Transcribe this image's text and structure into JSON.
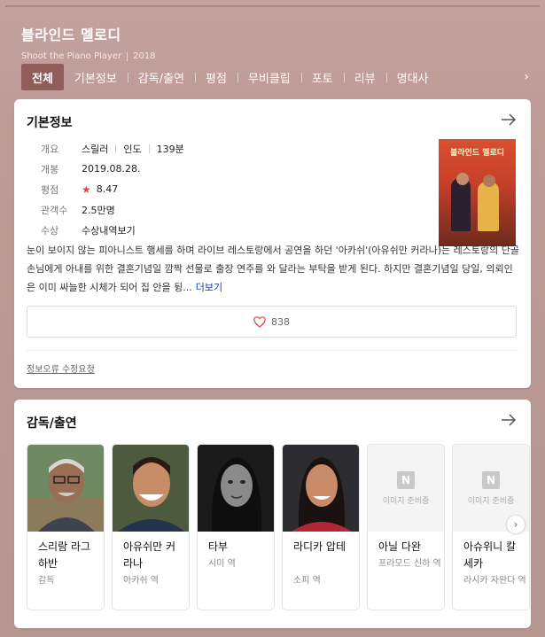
{
  "header": {
    "title": "블라인드 멜로디",
    "subtitle_en": "Shoot the Piano Player",
    "year": "2018"
  },
  "tabs": [
    {
      "label": "전체",
      "active": true
    },
    {
      "label": "기본정보"
    },
    {
      "label": "감독/출연"
    },
    {
      "label": "평점"
    },
    {
      "label": "무비클립"
    },
    {
      "label": "포토"
    },
    {
      "label": "리뷰"
    },
    {
      "label": "명대사"
    }
  ],
  "basic": {
    "title": "기본정보",
    "genre_label": "개요",
    "genre": "스릴러",
    "country": "인도",
    "runtime": "139분",
    "release_label": "개봉",
    "release": "2019.08.28.",
    "rating_label": "평점",
    "rating": "8.47",
    "audience_label": "관객수",
    "audience": "2.5만명",
    "award_label": "수상",
    "award_link": "수상내역보기",
    "poster_title": "블라인드 멜로디",
    "synopsis": "눈이 보이지 않는 피아니스트 행세를 하며 라이브 레스토랑에서 공연을 하던 '아카쉬'(아유쉬만 커라나)는 레스토랑의 단골 손님에게 아내를 위한 결혼기념일 깜짝 선물로 출장 연주를 와 달라는 부탁을 받게 된다. 하지만 결혼기념일 당일, 의뢰인은 이미 싸늘한 시체가 되어 집 안을 뒹...",
    "more": "더보기",
    "likes": "838",
    "report": "정보오류 수정요청"
  },
  "cast": {
    "title": "감독/출연",
    "no_image_text": "이미지 준비중",
    "people": [
      {
        "name": "스리람 라그하반",
        "role": "감독"
      },
      {
        "name": "아유쉬만 커라나",
        "role": "아카쉬 역"
      },
      {
        "name": "타부",
        "role": "시미 역"
      },
      {
        "name": "라디카 압테",
        "role": "소피 역"
      },
      {
        "name": "아닐 다완",
        "role": "프라모드 신하 역"
      },
      {
        "name": "아슈위니 칼세카",
        "role": "라시카 자완다 역"
      }
    ]
  },
  "colors": {
    "active_tab": "#8e5e58",
    "rating_star": "#e8453c",
    "link": "#1c3aa0"
  }
}
